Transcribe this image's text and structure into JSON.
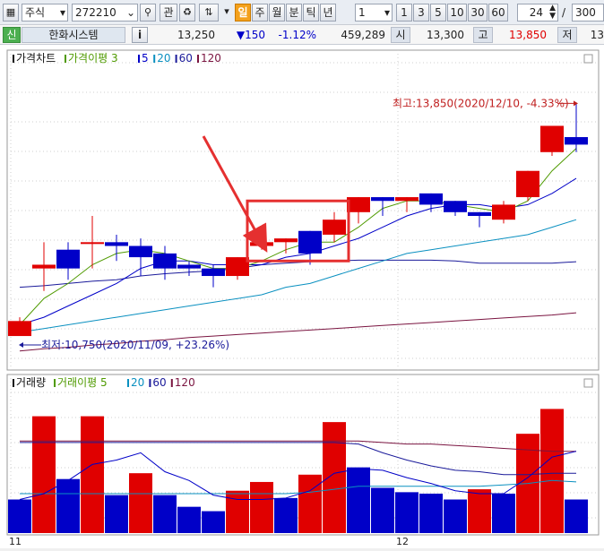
{
  "toolbar": {
    "market_type": "주식",
    "stock_code": "272210",
    "related_label": "관",
    "period_buttons": [
      "일",
      "주",
      "월",
      "분",
      "틱",
      "년"
    ],
    "active_period": "일",
    "interval_value": "1",
    "quick_intervals": [
      "1",
      "3",
      "5",
      "10",
      "30",
      "60"
    ],
    "count_value": "24",
    "count_separator": "/",
    "count_max": "300"
  },
  "quote": {
    "credit_badge": "신",
    "stock_name": "한화시스템",
    "info_label": "i",
    "price": "13,250",
    "change": "▼150",
    "change_rate": "-1.12%",
    "volume": "459,289",
    "open_label": "시",
    "open": "13,300",
    "high_label": "고",
    "high": "13,850",
    "low_label": "저",
    "low": "13"
  },
  "colors": {
    "up": "#e00000",
    "down": "#0000c8",
    "ma3": "#4f9a00",
    "ma5": "#0000c8",
    "ma20": "#0a90c0",
    "ma60": "#1a1a9a",
    "ma120": "#7a1440",
    "annotation_arrow": "#e53030",
    "highlight_box": "#e53030"
  },
  "chart_data": [
    {
      "type": "candlestick",
      "panel": "price",
      "legend": [
        {
          "label": "가격차트",
          "color": "#111111"
        },
        {
          "label": "가격이평 3",
          "color": "#4f9a00"
        },
        {
          "label": "5",
          "color": "#0000c8"
        },
        {
          "label": "20",
          "color": "#0a90c0"
        },
        {
          "label": "60",
          "color": "#1a1a9a"
        },
        {
          "label": "120",
          "color": "#7a1440"
        }
      ],
      "ylim": [
        10500,
        14200
      ],
      "candles": [
        {
          "o": 10750,
          "h": 11000,
          "l": 10750,
          "c": 10950
        },
        {
          "o": 11650,
          "h": 12000,
          "l": 11350,
          "c": 11700
        },
        {
          "o": 11900,
          "h": 12000,
          "l": 11500,
          "c": 11650
        },
        {
          "o": 12000,
          "h": 12350,
          "l": 11650,
          "c": 12000
        },
        {
          "o": 12000,
          "h": 12100,
          "l": 11750,
          "c": 11950
        },
        {
          "o": 11950,
          "h": 12050,
          "l": 11550,
          "c": 11800
        },
        {
          "o": 11850,
          "h": 11950,
          "l": 11500,
          "c": 11650
        },
        {
          "o": 11700,
          "h": 11750,
          "l": 11550,
          "c": 11650
        },
        {
          "o": 11650,
          "h": 11700,
          "l": 11400,
          "c": 11550
        },
        {
          "o": 11550,
          "h": 11800,
          "l": 11500,
          "c": 11800
        },
        {
          "o": 11950,
          "h": 12000,
          "l": 11900,
          "c": 12000
        },
        {
          "o": 12000,
          "h": 12050,
          "l": 11850,
          "c": 12050
        },
        {
          "o": 12150,
          "h": 12150,
          "l": 11700,
          "c": 11850
        },
        {
          "o": 12100,
          "h": 12400,
          "l": 12000,
          "c": 12300
        },
        {
          "o": 12400,
          "h": 12600,
          "l": 12250,
          "c": 12600
        },
        {
          "o": 12600,
          "h": 12600,
          "l": 12350,
          "c": 12550
        },
        {
          "o": 12550,
          "h": 12600,
          "l": 12400,
          "c": 12600
        },
        {
          "o": 12650,
          "h": 12650,
          "l": 12400,
          "c": 12500
        },
        {
          "o": 12550,
          "h": 12550,
          "l": 12350,
          "c": 12400
        },
        {
          "o": 12400,
          "h": 12400,
          "l": 12200,
          "c": 12350
        },
        {
          "o": 12300,
          "h": 12550,
          "l": 12250,
          "c": 12500
        },
        {
          "o": 12600,
          "h": 12950,
          "l": 12550,
          "c": 12950
        },
        {
          "o": 13200,
          "h": 13550,
          "l": 13150,
          "c": 13550
        },
        {
          "o": 13400,
          "h": 13850,
          "l": 13200,
          "c": 13300
        }
      ],
      "ma3": [
        10900,
        11250,
        11450,
        11700,
        11850,
        11900,
        11850,
        11750,
        11650,
        11650,
        11750,
        11900,
        12000,
        12000,
        12200,
        12450,
        12550,
        12550,
        12500,
        12450,
        12400,
        12550,
        12950,
        13250
      ],
      "ma5": [
        10900,
        11000,
        11150,
        11300,
        11450,
        11650,
        11750,
        11750,
        11700,
        11700,
        11700,
        11800,
        11850,
        11950,
        12050,
        12200,
        12350,
        12450,
        12500,
        12500,
        12450,
        12500,
        12650,
        12850
      ],
      "ma20": [
        10800,
        10850,
        10900,
        10950,
        11000,
        11050,
        11100,
        11150,
        11200,
        11250,
        11300,
        11400,
        11450,
        11550,
        11650,
        11750,
        11850,
        11900,
        11950,
        12000,
        12050,
        12100,
        12200,
        12300
      ],
      "ma60": [
        11400,
        11420,
        11450,
        11480,
        11500,
        11550,
        11580,
        11600,
        11620,
        11650,
        11700,
        11720,
        11740,
        11750,
        11760,
        11760,
        11760,
        11760,
        11750,
        11720,
        11720,
        11720,
        11720,
        11740
      ],
      "ma120": [
        10550,
        10580,
        10600,
        10630,
        10650,
        10680,
        10700,
        10730,
        10750,
        10770,
        10790,
        10810,
        10830,
        10850,
        10870,
        10890,
        10910,
        10930,
        10950,
        10970,
        10990,
        11010,
        11030,
        11060
      ],
      "annotations": {
        "high": "최고:13,850(2020/12/10, -4.33%)",
        "low": "최저:10,750(2020/11/09, +23.26%)"
      }
    },
    {
      "type": "bar",
      "panel": "volume",
      "legend": [
        {
          "label": "거래량",
          "color": "#111111"
        },
        {
          "label": "거래이평 5",
          "color": "#4f9a00"
        },
        {
          "label": "20",
          "color": "#0a90c0"
        },
        {
          "label": "60",
          "color": "#1a1a9a"
        },
        {
          "label": "120",
          "color": "#7a1440"
        }
      ],
      "ylim": [
        0,
        100
      ],
      "values": [
        23,
        80,
        37,
        80,
        26,
        41,
        26,
        18,
        15,
        29,
        35,
        24,
        40,
        76,
        45,
        31,
        28,
        27,
        23,
        30,
        27,
        68,
        85,
        23
      ],
      "colors": [
        "down",
        "up",
        "down",
        "up",
        "down",
        "up",
        "down",
        "down",
        "down",
        "up",
        "up",
        "down",
        "up",
        "up",
        "down",
        "down",
        "down",
        "down",
        "down",
        "up",
        "down",
        "up",
        "up",
        "down"
      ],
      "ma5": [
        23,
        27,
        36,
        47,
        50,
        55,
        42,
        36,
        26,
        23,
        23,
        24,
        29,
        41,
        44,
        43,
        38,
        34,
        29,
        27,
        27,
        38,
        52,
        56
      ],
      "ma20": [
        27,
        27,
        27,
        27,
        27,
        27,
        27,
        27,
        27,
        27,
        27,
        27,
        28,
        30,
        32,
        32,
        32,
        32,
        32,
        32,
        33,
        34,
        36,
        35
      ],
      "ma60": [
        62,
        62,
        62,
        62,
        62,
        62,
        62,
        62,
        62,
        62,
        62,
        62,
        62,
        62,
        61,
        55,
        50,
        46,
        43,
        42,
        40,
        40,
        41,
        41
      ],
      "ma120": [
        63,
        63,
        63,
        63,
        63,
        63,
        63,
        63,
        63,
        63,
        63,
        63,
        63,
        63,
        63,
        62,
        61,
        61,
        60,
        59,
        58,
        57,
        56,
        56
      ],
      "x_ticks": [
        {
          "label": "11",
          "index": 0
        },
        {
          "label": "12",
          "index": 16
        }
      ]
    }
  ]
}
